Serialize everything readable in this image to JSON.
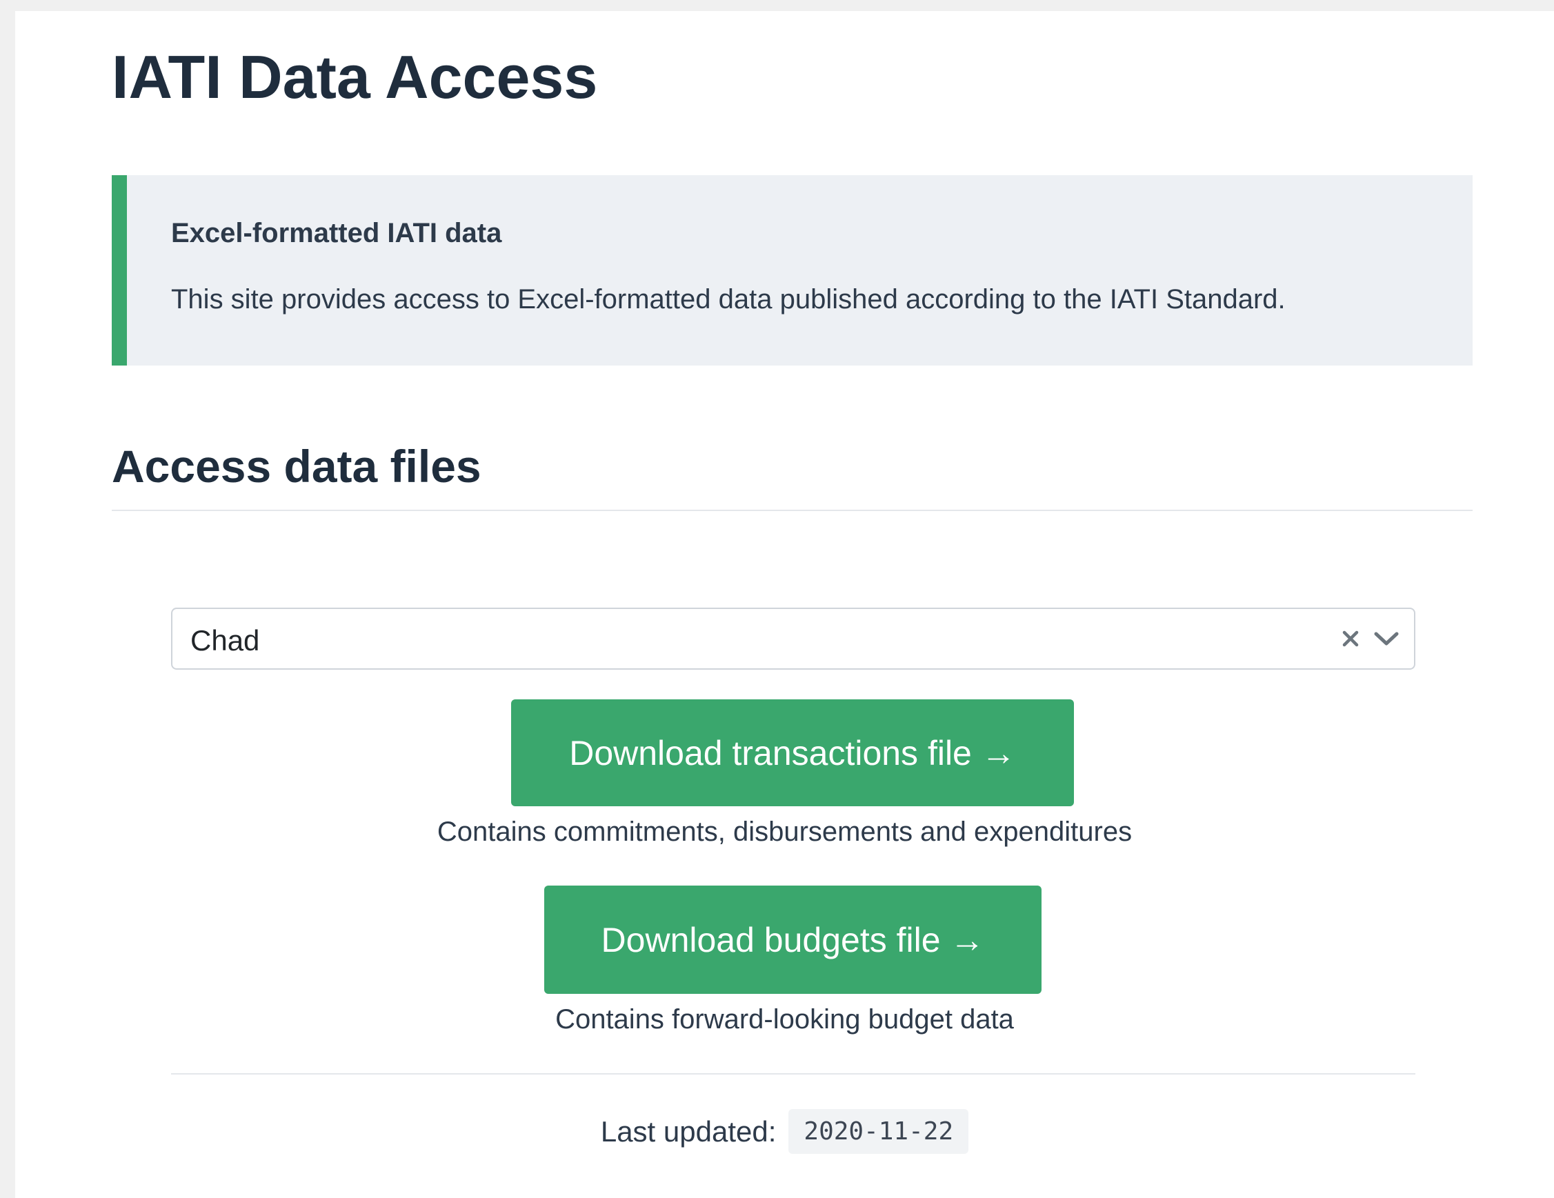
{
  "header": {
    "title": "IATI Data Access"
  },
  "callout": {
    "heading": "Excel-formatted IATI data",
    "text": "This site provides access to Excel-formatted data published according to the IATI Standard."
  },
  "section": {
    "heading": "Access data files"
  },
  "country_select": {
    "value": "Chad",
    "clear_icon": "close-icon",
    "toggle_icon": "chevron-down-icon"
  },
  "downloads": {
    "transactions": {
      "label": "Download transactions file →",
      "caption": "Contains commitments, disbursements and expenditures"
    },
    "budgets": {
      "label": "Download budgets file →",
      "caption": "Contains forward-looking budget data"
    }
  },
  "footer": {
    "last_updated_label": "Last updated:",
    "last_updated_value": "2020-11-22"
  },
  "colors": {
    "accent_green": "#3aa76d",
    "heading_text": "#1f2d3d",
    "callout_background": "#edf0f4"
  }
}
